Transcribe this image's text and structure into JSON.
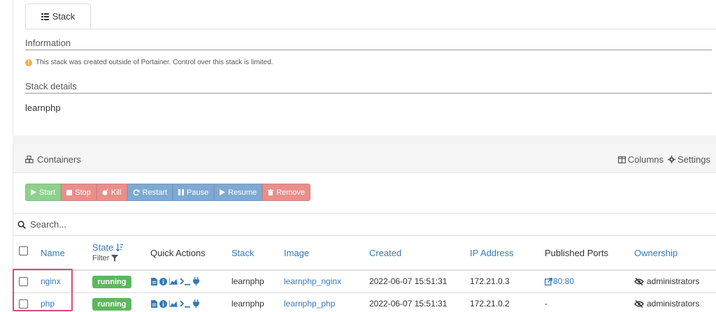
{
  "tab": {
    "label": "Stack"
  },
  "information": {
    "heading": "Information",
    "message": "This stack was created outside of Portainer. Control over this stack is limited."
  },
  "stack_details": {
    "heading": "Stack details",
    "name": "learnphp"
  },
  "containers": {
    "title": "Containers",
    "columns_label": "Columns",
    "settings_label": "Settings",
    "actions": [
      "Start",
      "Stop",
      "Kill",
      "Restart",
      "Pause",
      "Resume",
      "Remove"
    ],
    "search_placeholder": "Search...",
    "headers": {
      "name": "Name",
      "state": "State",
      "filter": "Filter",
      "quick_actions": "Quick Actions",
      "stack": "Stack",
      "image": "Image",
      "created": "Created",
      "ip": "IP Address",
      "ports": "Published Ports",
      "ownership": "Ownership"
    },
    "rows": [
      {
        "name": "nginx",
        "state": "running",
        "stack": "learnphp",
        "image": "learnphp_nginx",
        "created": "2022-06-07 15:51:31",
        "ip": "172.21.0.3",
        "ports": "80:80",
        "ownership": "administrators"
      },
      {
        "name": "php",
        "state": "running",
        "stack": "learnphp",
        "image": "learnphp_php",
        "created": "2022-06-07 15:51:31",
        "ip": "172.21.0.2",
        "ports": "-",
        "ownership": "administrators"
      }
    ]
  },
  "colors": {
    "link": "#337ab7",
    "running": "#5cb85c",
    "highlight": "#e0457b",
    "warning": "#f0ad4e"
  }
}
